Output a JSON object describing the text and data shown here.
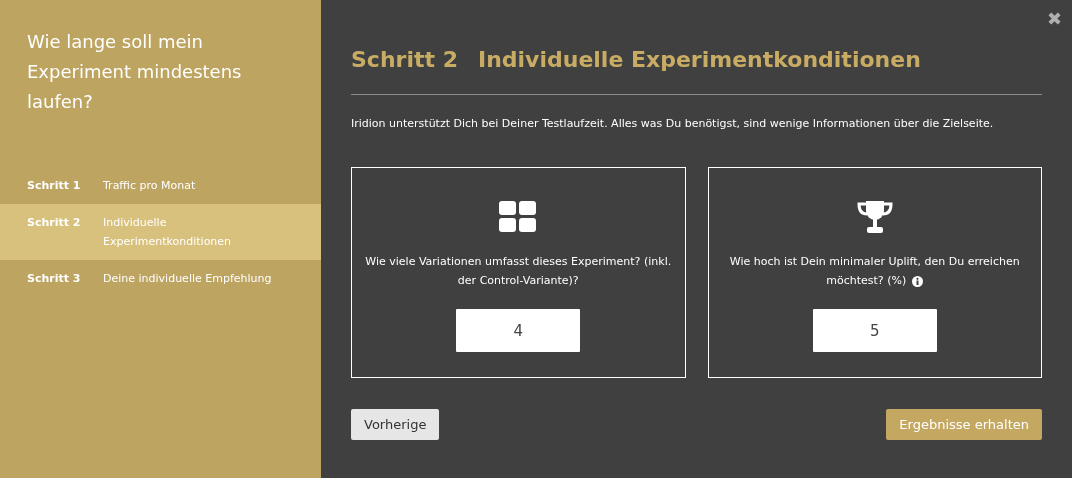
{
  "sidebar": {
    "title": "Wie lange soll mein Experiment mindestens laufen?",
    "steps": [
      {
        "label": "Schritt 1",
        "text": "Traffic pro Monat",
        "selected": false
      },
      {
        "label": "Schritt 2",
        "text": "Individuelle Experimentkonditionen",
        "selected": true
      },
      {
        "label": "Schritt 3",
        "text": "Deine individuelle Empfehlung",
        "selected": false
      }
    ]
  },
  "close": "✖",
  "heading": {
    "step": "Schritt 2",
    "title": "Individuelle Experimentkonditionen"
  },
  "intro": "Iridion unterstützt Dich bei Deiner Testlaufzeit. Alles was Du benötigst, sind wenige Informationen über die Zielseite.",
  "cards": [
    {
      "kind": "grid",
      "question": "Wie viele Variationen umfasst dieses Experiment? (inkl. der Control-Variante)?",
      "value": "4",
      "info": false
    },
    {
      "kind": "trophy",
      "question": "Wie hoch ist Dein minimaler Uplift, den Du erreichen möchtest? (%)",
      "value": "5",
      "info": true
    }
  ],
  "buttons": {
    "back": "Vorherige",
    "next": "Ergebnisse erhalten"
  }
}
